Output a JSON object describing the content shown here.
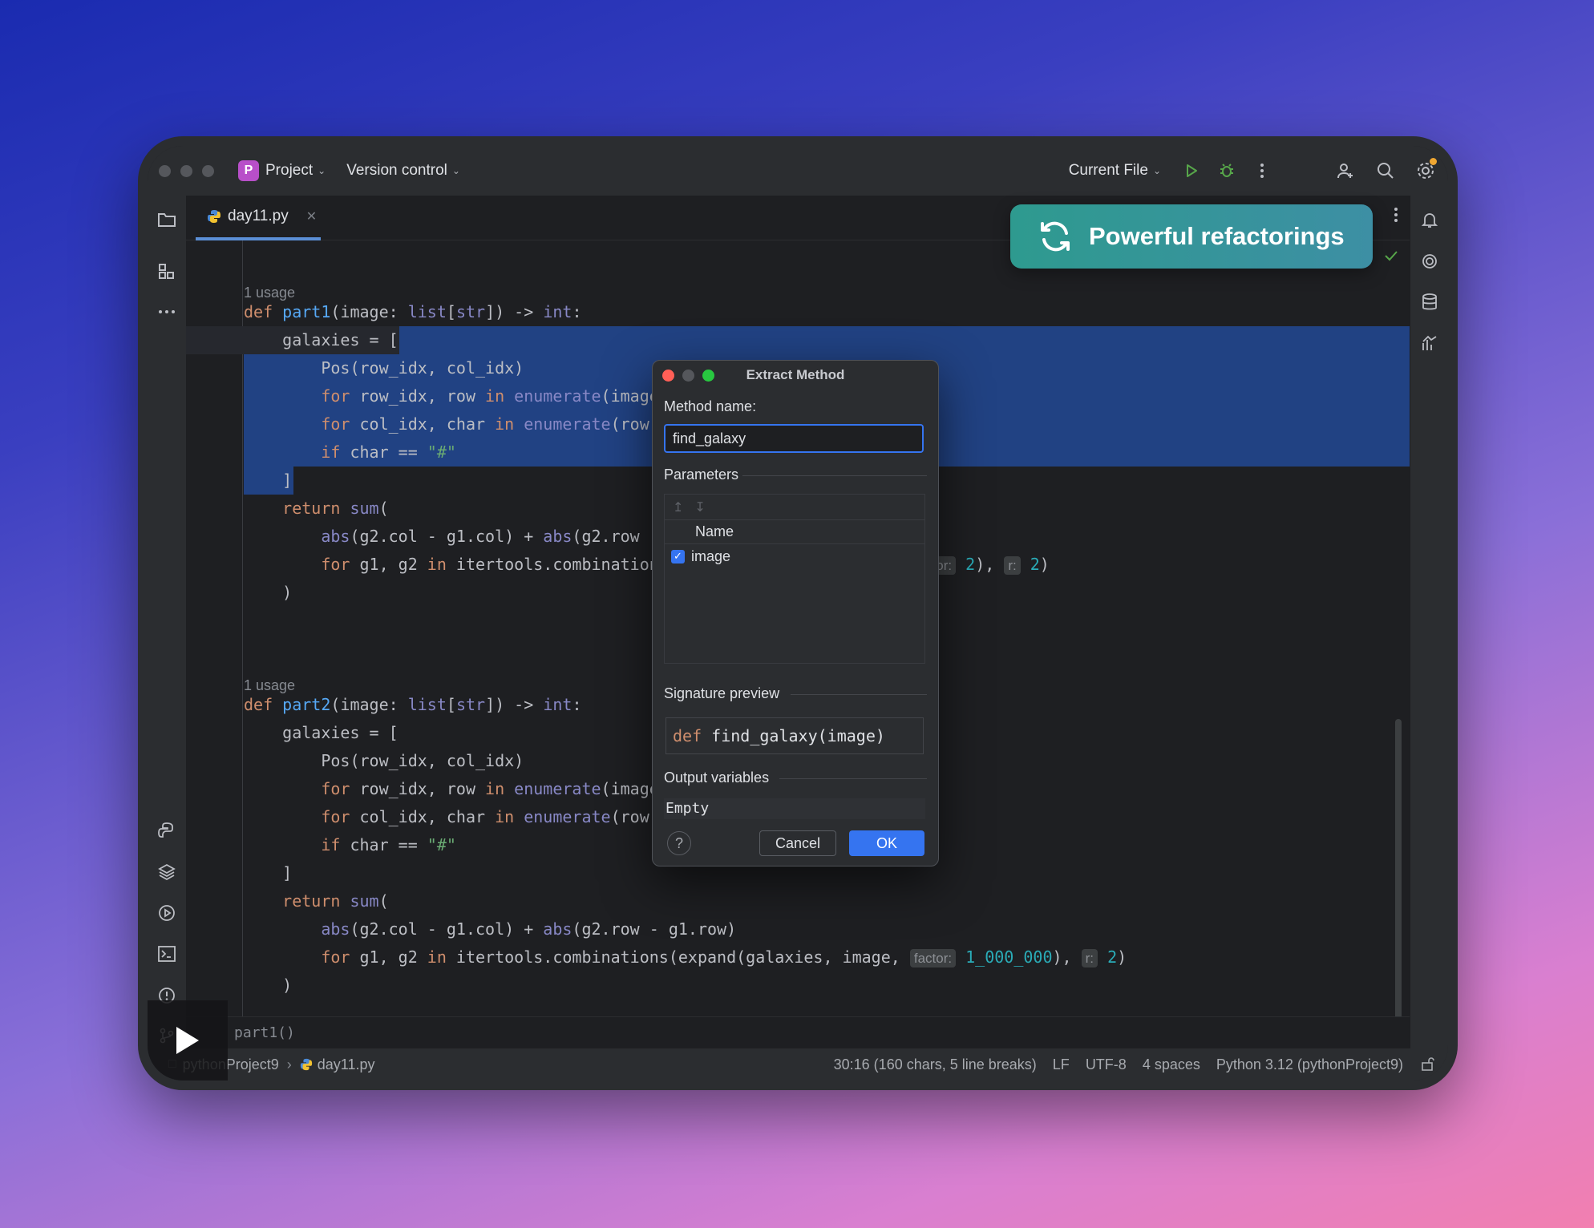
{
  "titlebar": {
    "project_badge": "P",
    "project_label": "Project",
    "vcs_label": "Version control",
    "run_config": "Current File"
  },
  "tab": {
    "label": "day11.py"
  },
  "promo": {
    "text": "Powerful refactorings"
  },
  "editor": {
    "usage1": "1 usage",
    "usage2": "1 usage"
  },
  "dialog": {
    "title": "Extract Method",
    "method_name_label": "Method name:",
    "method_name_value": "find_galaxy",
    "parameters_label": "Parameters",
    "param_column_name": "Name",
    "params": [
      {
        "name": "image",
        "checked": true
      }
    ],
    "signature_label": "Signature preview",
    "signature_kw": "def",
    "signature_rest": " find_galaxy(image)",
    "output_label": "Output variables",
    "output_value": "Empty",
    "help": "?",
    "cancel": "Cancel",
    "ok": "OK"
  },
  "breadcrumb": {
    "item": "part1()"
  },
  "status": {
    "project": "pythonProject9",
    "file": "day11.py",
    "position": "30:16 (160 chars, 5 line breaks)",
    "line_sep": "LF",
    "encoding": "UTF-8",
    "indent": "4 spaces",
    "interpreter": "Python 3.12 (pythonProject9)"
  },
  "colors": {
    "selection": "#214283",
    "accent": "#3574f0",
    "promo_start": "#2e9a8f",
    "promo_end": "#3d8fa4"
  }
}
